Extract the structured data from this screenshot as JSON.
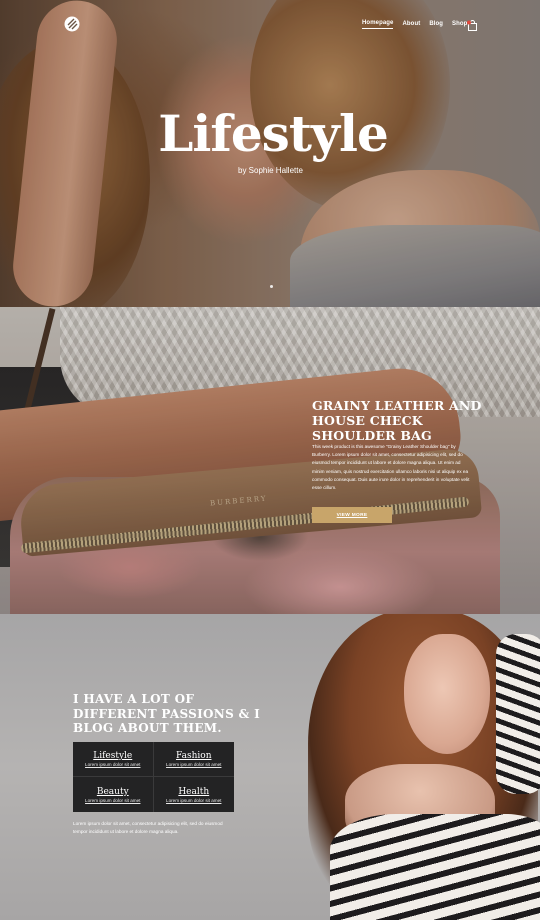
{
  "nav": {
    "items": [
      {
        "label": "Homepage",
        "active": true
      },
      {
        "label": "About",
        "active": false
      },
      {
        "label": "Blog",
        "active": false
      },
      {
        "label": "Shop",
        "active": false
      }
    ],
    "cart_icon": "shopping-bag-icon",
    "logo_icon": "brand-logo-icon"
  },
  "hero": {
    "title": "Lifestyle",
    "subtitle": "by Sophie Hallette"
  },
  "product": {
    "title": "GRAINY LEATHER AND HOUSE CHECK SHOULDER BAG",
    "body": "This week product is this awesome \"Grainy Leather Shoulder bag\" by Burberry. Lorem ipsum dolor sit amet, consectetur adipisicing elit, sed do eiusmod tempor incididunt ut labore et dolore magna aliqua. Ut enim ad minim veniam, quis nostrud exercitation ullamco laboris nisi ut aliquip ex ea commodo consequat. Duis aute irure dolor in reprehenderit in voluptate velit esse cillum.",
    "button_label": "VIEW MORE",
    "brand_stamp": "BURBERRY"
  },
  "passions": {
    "title": "I HAVE A LOT OF DIFFERENT PASSIONS & I BLOG ABOUT THEM.",
    "categories": [
      {
        "name": "Lifestyle",
        "desc": "Lorem ipsum dolor sit amet"
      },
      {
        "name": "Fashion",
        "desc": "Lorem ipsum dolor sit amet"
      },
      {
        "name": "Beauty",
        "desc": "Lorem ipsum dolor sit amet"
      },
      {
        "name": "Health",
        "desc": "Lorem ipsum dolor sit amet"
      }
    ],
    "text": "Lorem ipsum dolor sit amet, consectetur adipisicing elit, sed do eiusmod tempor incididunt ut labore et dolore magna aliqua."
  },
  "colors": {
    "accent": "#c8a56a",
    "grid_bg": "#232324"
  }
}
